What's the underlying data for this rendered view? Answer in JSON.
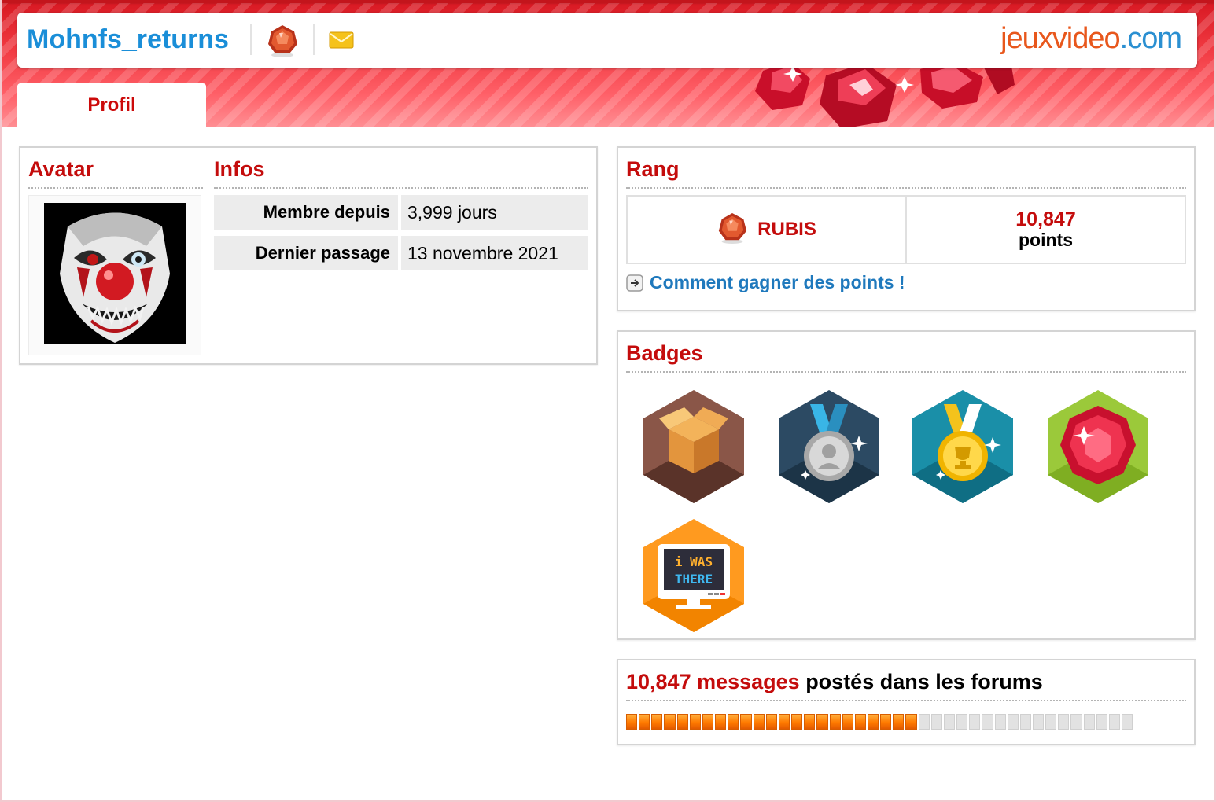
{
  "header": {
    "username": "Mohnfs_returns",
    "rank_icon": "ruby-gem-icon",
    "mail_icon": "envelope-icon",
    "logo_part1": "jeuxvideo",
    "logo_part2": ".com"
  },
  "tabs": [
    {
      "label": "Profil",
      "active": true
    }
  ],
  "avatar": {
    "title": "Avatar"
  },
  "infos": {
    "title": "Infos",
    "rows": [
      {
        "label": "Membre depuis",
        "value": "3,999 jours"
      },
      {
        "label": "Dernier passage",
        "value": "13 novembre 2021"
      }
    ]
  },
  "rang": {
    "title": "Rang",
    "rank_name": "RUBIS",
    "points_value": "10,847",
    "points_label": "points",
    "link_label": "Comment gagner des points !"
  },
  "badges": {
    "title": "Badges",
    "items": [
      {
        "name": "box-badge",
        "text": ""
      },
      {
        "name": "silver-medal-badge",
        "text": ""
      },
      {
        "name": "gold-medal-badge",
        "text": ""
      },
      {
        "name": "ruby-badge",
        "text": ""
      },
      {
        "name": "i-was-there-badge",
        "line1": "i WAS",
        "line2": "THERE"
      }
    ]
  },
  "messages": {
    "count_text": "10,847 messages",
    "suffix_text": " postés dans les forums",
    "progress_fraction": 0.57
  },
  "colors": {
    "brand_red": "#c40c0c",
    "username_blue": "#1a8ed8",
    "link_blue": "#1f79bd",
    "logo_orange": "#e8571c",
    "progress_orange": "#ff7a00"
  }
}
